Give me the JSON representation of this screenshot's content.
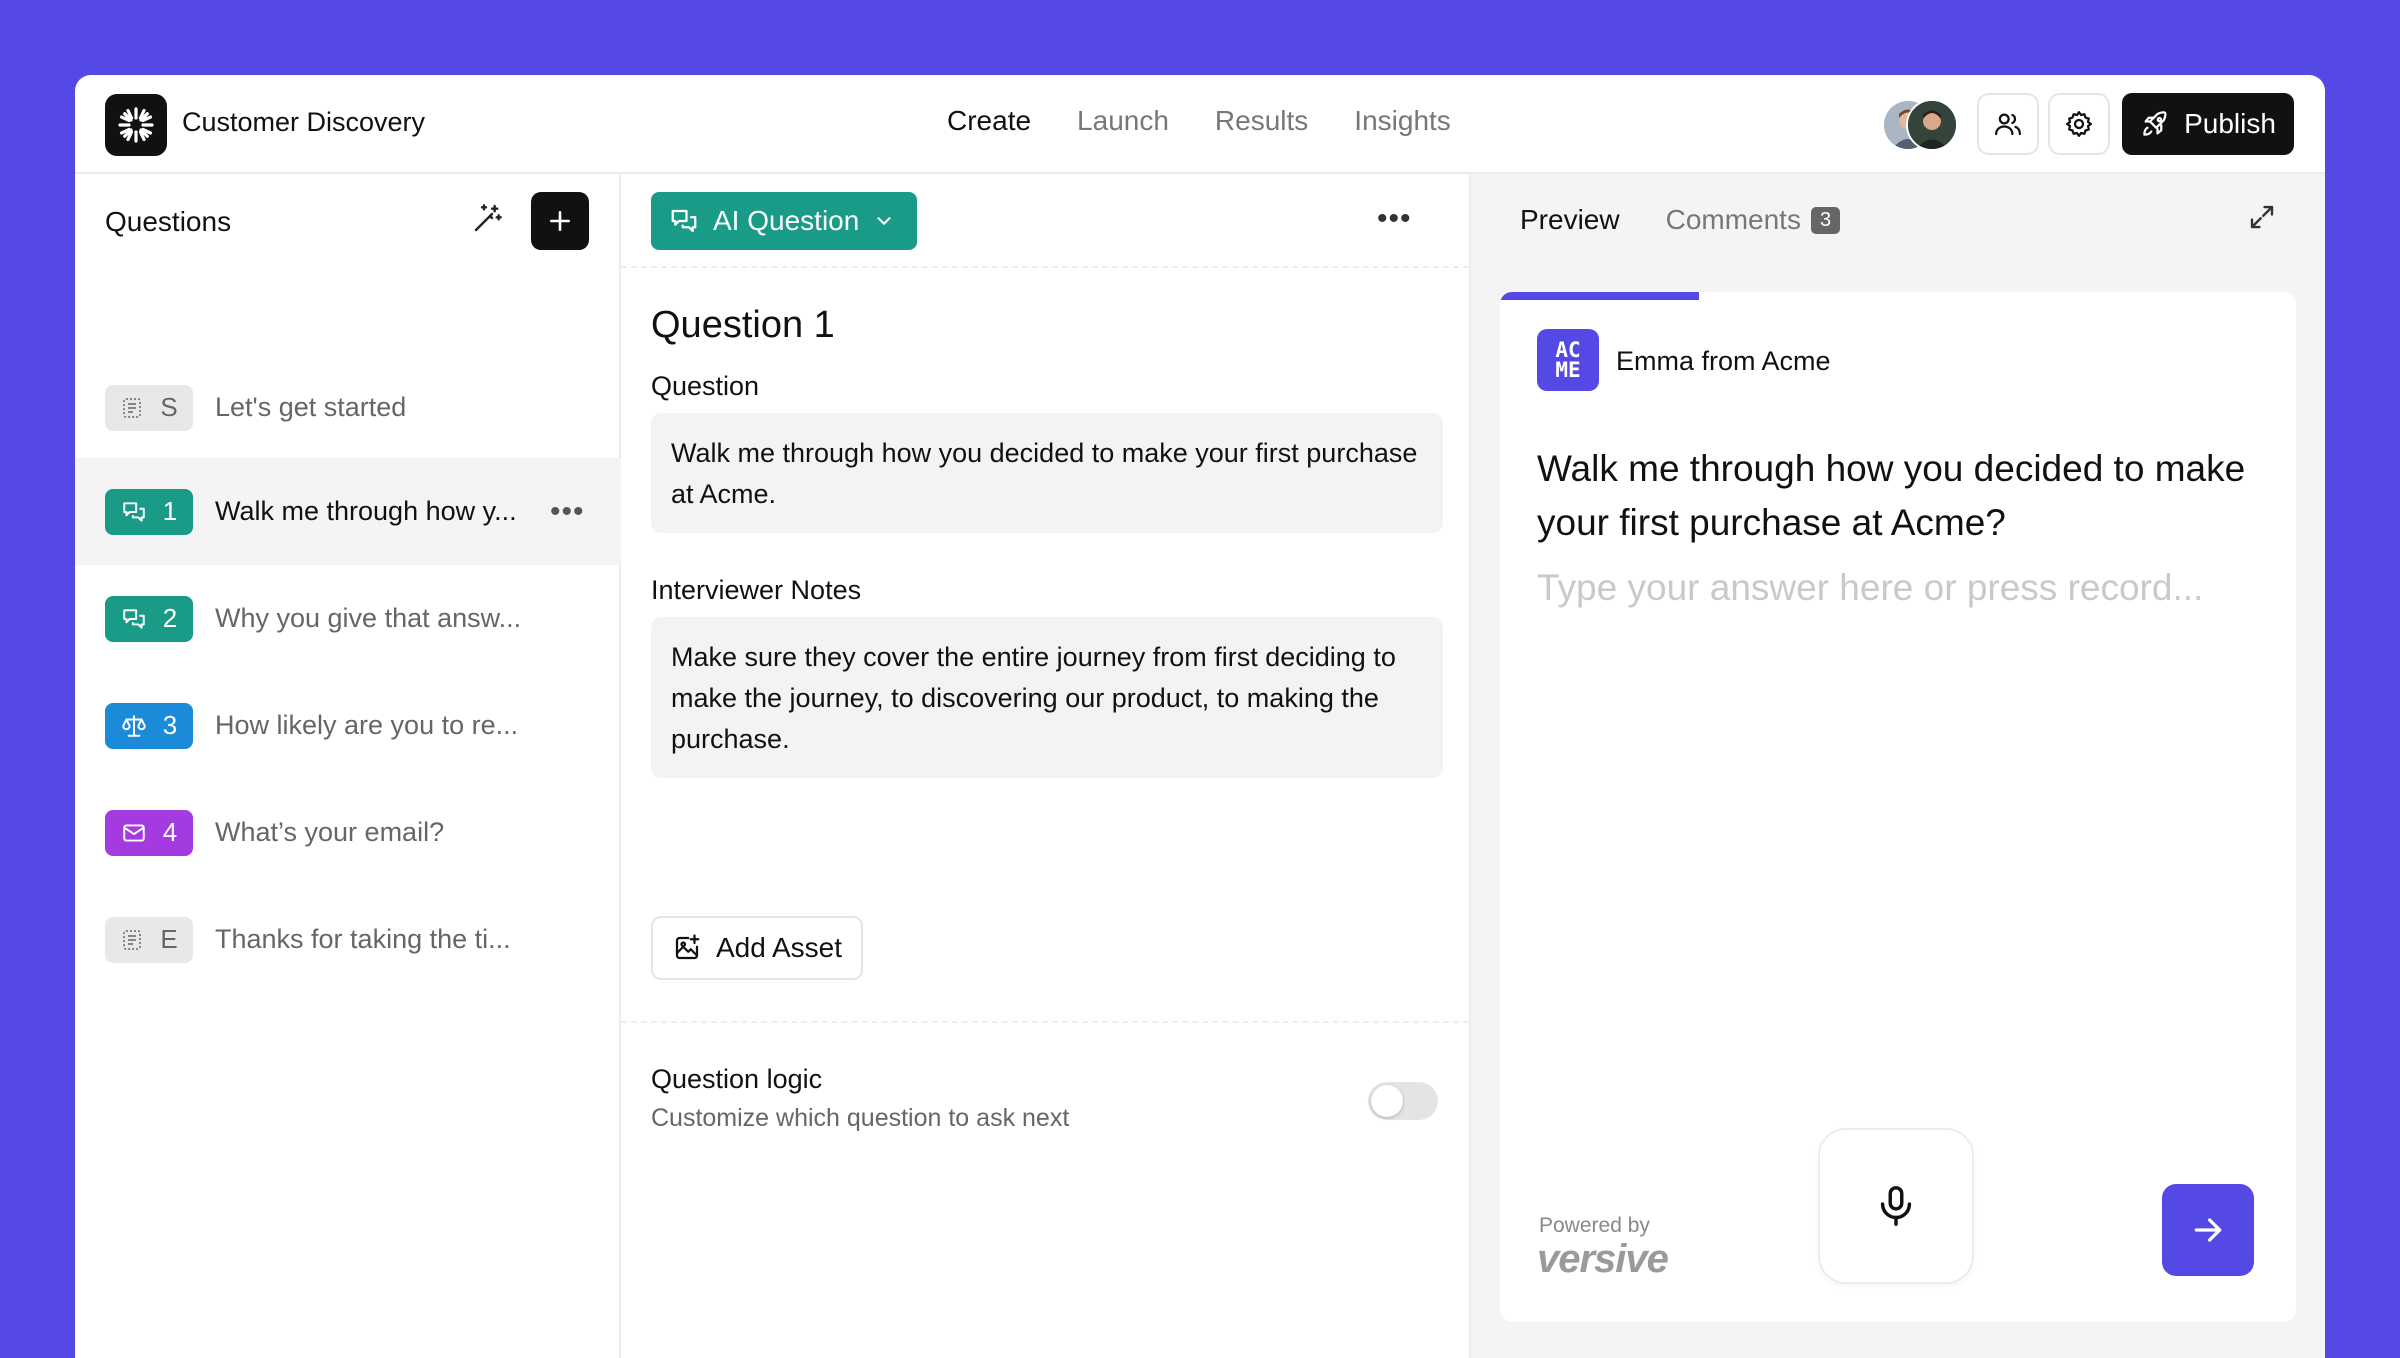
{
  "header": {
    "title": "Customer Discovery",
    "nav": [
      {
        "label": "Create",
        "active": true
      },
      {
        "label": "Launch",
        "active": false
      },
      {
        "label": "Results",
        "active": false
      },
      {
        "label": "Insights",
        "active": false
      }
    ],
    "publish_label": "Publish"
  },
  "sidebar": {
    "title": "Questions",
    "items": [
      {
        "badge": "S",
        "text": "Let's get started",
        "color": "#e8e8e8",
        "icon": "form-icon",
        "active": false
      },
      {
        "badge": "1",
        "text": "Walk me through how y...",
        "color": "#1a9b87",
        "icon": "chat-icon",
        "active": true
      },
      {
        "badge": "2",
        "text": "Why you give that answ...",
        "color": "#1a9b87",
        "icon": "chat-icon",
        "active": false
      },
      {
        "badge": "3",
        "text": "How likely are you to re...",
        "color": "#1b8ad8",
        "icon": "scale-icon",
        "active": false
      },
      {
        "badge": "4",
        "text": "What’s your email?",
        "color": "#a33be0",
        "icon": "mail-icon",
        "active": false
      },
      {
        "badge": "E",
        "text": "Thanks for taking the ti...",
        "color": "#e8e8e8",
        "icon": "form-icon",
        "active": false
      }
    ]
  },
  "editor": {
    "type_label": "AI Question",
    "heading": "Question 1",
    "question_label": "Question",
    "question_text": "Walk me through how you decided to make your first purchase at Acme.",
    "notes_label": "Interviewer Notes",
    "notes_text": "Make sure they cover the entire journey from first deciding to make the journey, to discovering our product, to making the purchase.",
    "add_asset_label": "Add Asset",
    "logic_title": "Question logic",
    "logic_subtitle": "Customize which question to ask next",
    "logic_enabled": false
  },
  "preview": {
    "tab_preview": "Preview",
    "tab_comments": "Comments",
    "comments_count": "3",
    "progress": 0.25,
    "brand_top": "AC",
    "brand_bottom": "ME",
    "sender": "Emma from Acme",
    "question": "Walk me through how you decided to make your first purchase at Acme?",
    "answer_placeholder": "Type your answer here or press record...",
    "powered_by": "Powered by",
    "powered_brand": "versive"
  },
  "colors": {
    "accent": "#5549e6",
    "ai_question": "#1a9b87"
  }
}
